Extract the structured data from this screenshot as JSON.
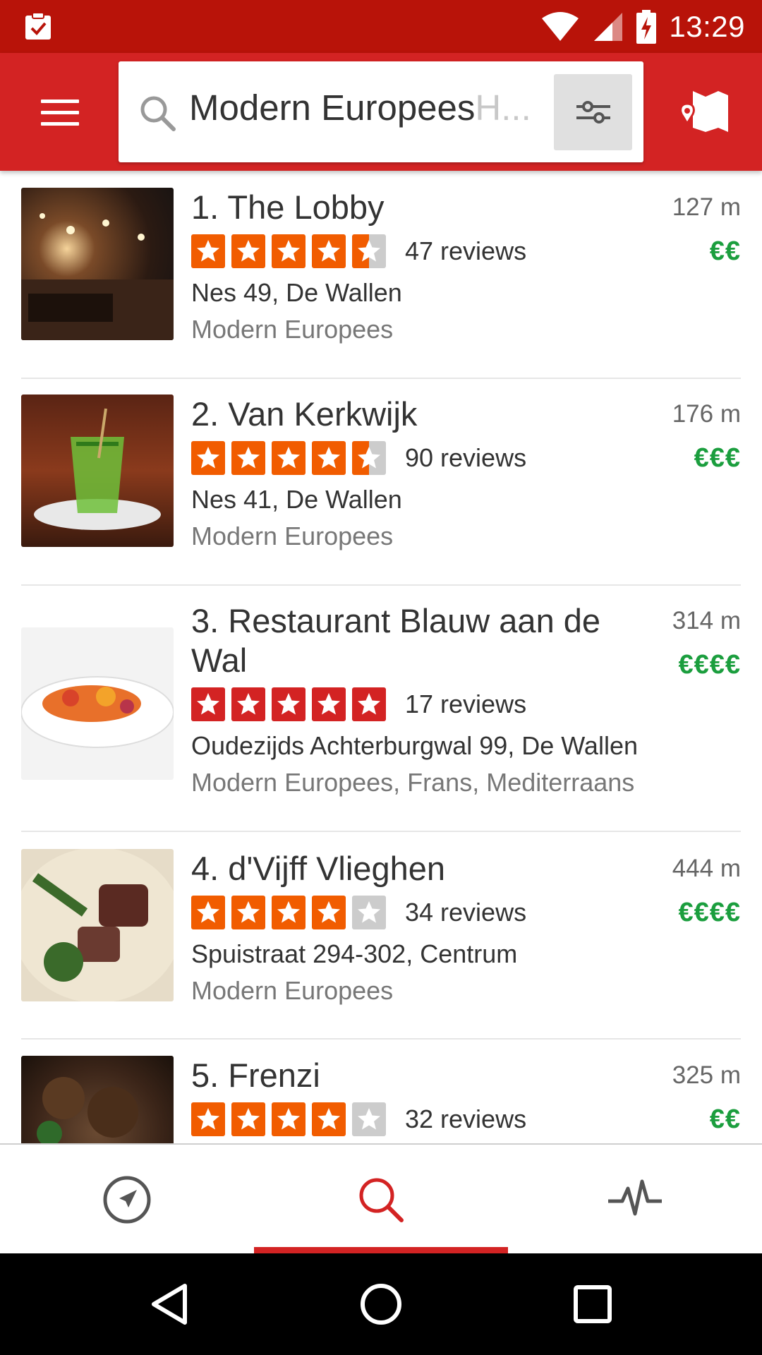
{
  "status_bar": {
    "time": "13:29",
    "icons": [
      "clipboard-check-icon",
      "wifi-icon",
      "cell-signal-icon",
      "battery-charging-icon"
    ]
  },
  "app_bar": {
    "menu_icon": "hamburger-menu-icon",
    "search": {
      "query": "Modern Europees",
      "hint_overflow": "H...",
      "icon": "search-icon"
    },
    "filter_icon": "filter-sliders-icon",
    "map_icon": "map-pin-icon"
  },
  "colors": {
    "brand_red": "#d32323",
    "status_red": "#b81309",
    "price_green": "#1b9e3e",
    "star_red": "#d32323",
    "star_orange": "#f15c00",
    "star_grey": "#cccccc"
  },
  "results": [
    {
      "title": "1. The Lobby",
      "rating": 4.5,
      "reviews": "47 reviews",
      "address": "Nes 49, De Wallen",
      "category": "Modern Europees",
      "distance": "127 m",
      "price": "€€"
    },
    {
      "title": "2. Van Kerkwijk",
      "rating": 4.5,
      "reviews": "90 reviews",
      "address": "Nes 41, De Wallen",
      "category": "Modern Europees",
      "distance": "176 m",
      "price": "€€€"
    },
    {
      "title": "3. Restaurant Blauw aan de Wal",
      "rating": 5,
      "reviews": "17 reviews",
      "address": "Oudezijds Achterburgwal 99, De Wallen",
      "category": "Modern Europees, Frans, Mediterraans",
      "distance": "314 m",
      "price": "€€€€"
    },
    {
      "title": "4. d'Vijff Vlieghen",
      "rating": 4,
      "reviews": "34 reviews",
      "address": "Spuistraat 294-302, Centrum",
      "category": "Modern Europees",
      "distance": "444 m",
      "price": "€€€€"
    },
    {
      "title": "5. Frenzi",
      "rating": 4,
      "reviews": "32 reviews",
      "address": "",
      "category": "",
      "distance": "325 m",
      "price": "€€"
    }
  ],
  "bottom_nav": {
    "items": [
      "nearby-compass-icon",
      "search-icon",
      "activity-pulse-icon"
    ],
    "active_index": 1
  },
  "system_nav": [
    "back-icon",
    "home-icon",
    "recents-icon"
  ]
}
